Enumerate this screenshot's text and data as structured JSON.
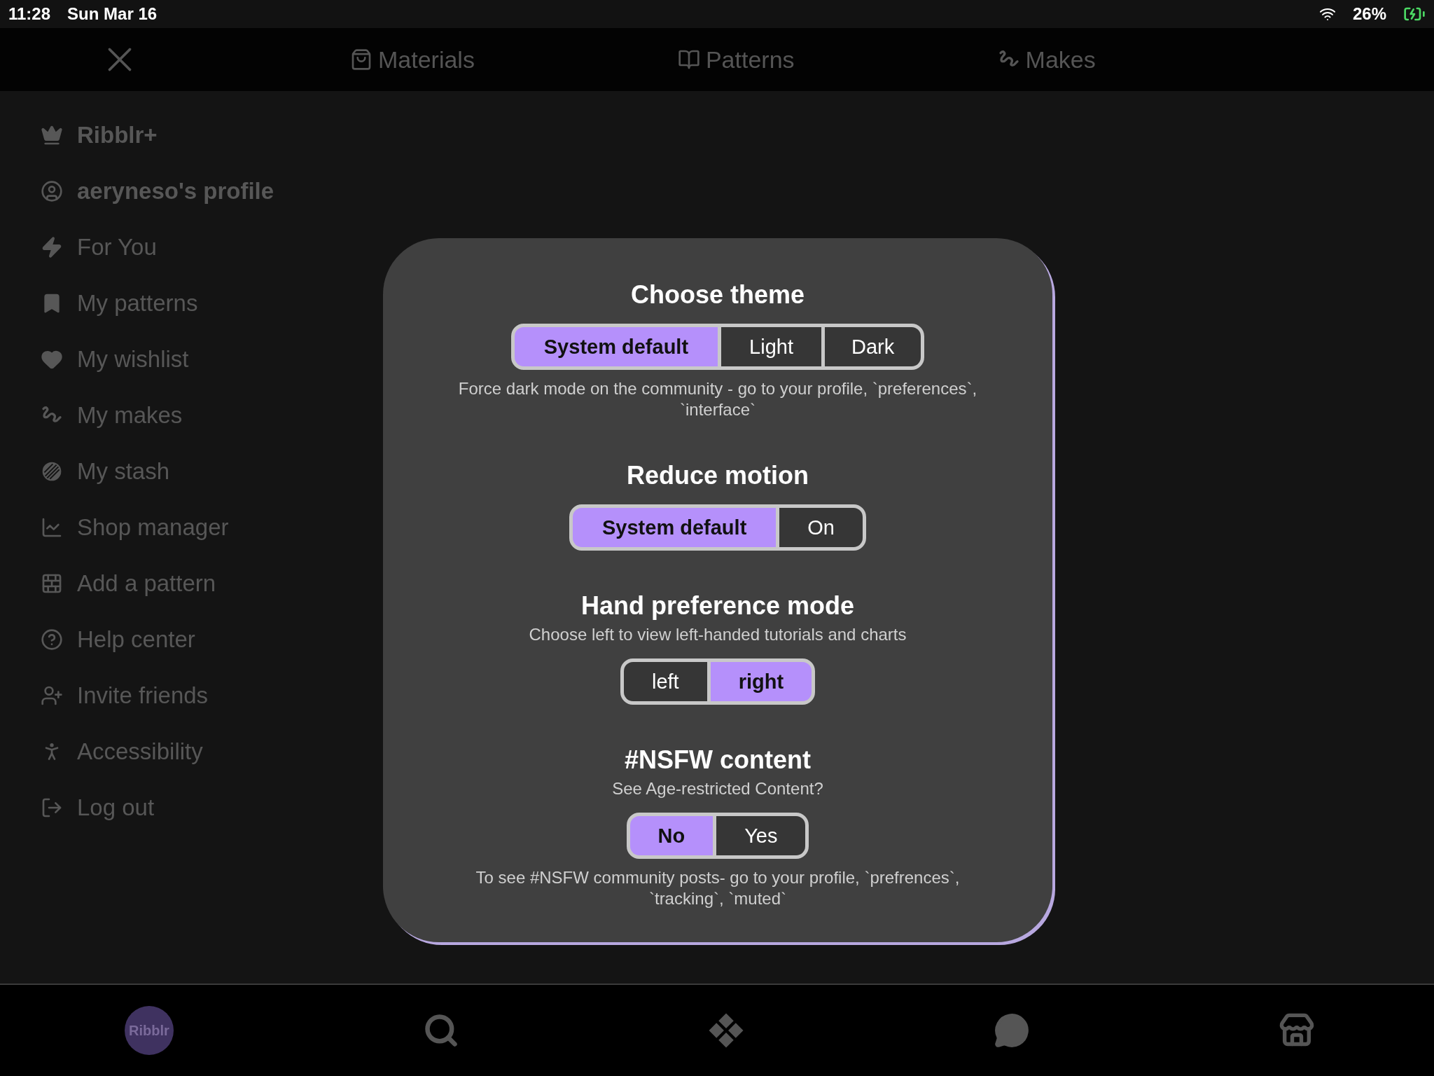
{
  "status_bar": {
    "time": "11:28",
    "date": "Sun Mar 16",
    "battery": "26%"
  },
  "top_nav": {
    "tabs": [
      {
        "label": "Materials"
      },
      {
        "label": "Patterns"
      },
      {
        "label": "Makes"
      }
    ]
  },
  "sidebar": {
    "items": [
      {
        "label": "Ribblr+",
        "kind": "account"
      },
      {
        "label": "aeryneso's profile",
        "kind": "account"
      },
      {
        "label": "For You",
        "kind": "link"
      },
      {
        "label": "My patterns",
        "kind": "link"
      },
      {
        "label": "My wishlist",
        "kind": "link"
      },
      {
        "label": "My makes",
        "kind": "link"
      },
      {
        "label": "My stash",
        "kind": "link"
      },
      {
        "label": "Shop manager",
        "kind": "link"
      },
      {
        "label": "Add a pattern",
        "kind": "link"
      },
      {
        "label": "Help center",
        "kind": "link"
      },
      {
        "label": "Invite friends",
        "kind": "link"
      },
      {
        "label": "Accessibility",
        "kind": "link"
      },
      {
        "label": "Log out",
        "kind": "link"
      }
    ]
  },
  "modal": {
    "sections": [
      {
        "title": "Choose theme",
        "options": [
          {
            "label": "System default",
            "selected": true
          },
          {
            "label": "Light",
            "selected": false
          },
          {
            "label": "Dark",
            "selected": false
          }
        ],
        "note": "Force dark mode on the community - go to your profile, `preferences`, `interface`"
      },
      {
        "title": "Reduce motion",
        "options": [
          {
            "label": "System default",
            "selected": true
          },
          {
            "label": "On",
            "selected": false
          }
        ]
      },
      {
        "title": "Hand preference mode",
        "subtitle": "Choose left to view left-handed tutorials and charts",
        "options": [
          {
            "label": "left",
            "selected": false
          },
          {
            "label": "right",
            "selected": true
          }
        ]
      },
      {
        "title": "#NSFW content",
        "subtitle": "See Age-restricted Content?",
        "options": [
          {
            "label": "No",
            "selected": true
          },
          {
            "label": "Yes",
            "selected": false
          }
        ],
        "note": "To see #NSFW community posts- go to your profile, `prefrences`, `tracking`, `muted`"
      }
    ]
  },
  "bottom_bar": {
    "avatar_text": "Ribblr"
  }
}
